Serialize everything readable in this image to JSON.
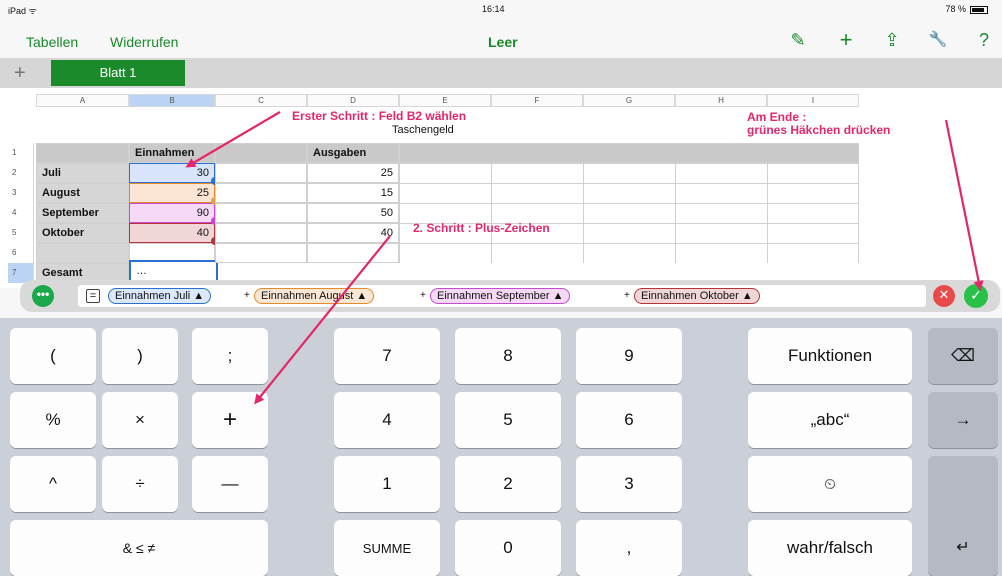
{
  "status": {
    "device": "iPad",
    "wifi": "ᯤ",
    "time": "16:14",
    "battery": "78 %"
  },
  "nav": {
    "tables": "Tabellen",
    "undo": "Widerrufen",
    "title": "Leer",
    "icons": [
      "brush-icon",
      "plus-icon",
      "share-icon",
      "wrench-icon",
      "help-icon"
    ],
    "icon_glyphs": [
      "✎",
      "+",
      "⇪",
      "🔧",
      "?"
    ]
  },
  "tabs": {
    "add": "+",
    "active": "Blatt 1"
  },
  "sheet": {
    "columns": [
      "A",
      "B",
      "C",
      "D",
      "E",
      "F",
      "G",
      "H",
      "I"
    ],
    "rows": [
      "1",
      "2",
      "3",
      "4",
      "5",
      "6",
      "7"
    ],
    "title": "Taschengeld",
    "header_income": "Einnahmen",
    "header_expenses": "Ausgaben",
    "labels": [
      "Juli",
      "August",
      "September",
      "Oktober",
      "",
      "Gesamt"
    ],
    "income": [
      "30",
      "25",
      "90",
      "40"
    ],
    "expenses": [
      "25",
      "15",
      "50",
      "40"
    ],
    "total_cell": "…"
  },
  "formula": {
    "dots": "•••",
    "eq": "=",
    "tokens": [
      "Einnahmen Juli ▲",
      "Einnahmen August ▲",
      "Einnahmen September ▲",
      "Einnahmen Oktober ▲"
    ],
    "plus": "+",
    "cancel": "✕",
    "ok": "✓",
    "token_colors": [
      "#2a6fd4",
      "#e58b2a",
      "#c64ad4",
      "#b8323a"
    ]
  },
  "keyboard": {
    "row1": [
      "(",
      ")",
      ";",
      "7",
      "8",
      "9",
      "Funktionen",
      "⌫"
    ],
    "row2": [
      "%",
      "×",
      "+",
      "4",
      "5",
      "6",
      "„abc“",
      "→"
    ],
    "row3": [
      "^",
      "÷",
      "—",
      "1",
      "2",
      "3",
      "⏲",
      ""
    ],
    "row4": [
      "& ≤ ≠",
      "SUMME",
      "0",
      ",",
      "wahr/falsch",
      "↵"
    ]
  },
  "annotations": {
    "step1": "Erster Schritt : Feld B2 wählen",
    "step2": "2. Schritt : Plus-Zeichen",
    "end1": "Am Ende :",
    "end2": "grünes Häkchen drücken"
  },
  "colors": {
    "accent": "#1a8a2a",
    "annotation": "#e4266b"
  }
}
